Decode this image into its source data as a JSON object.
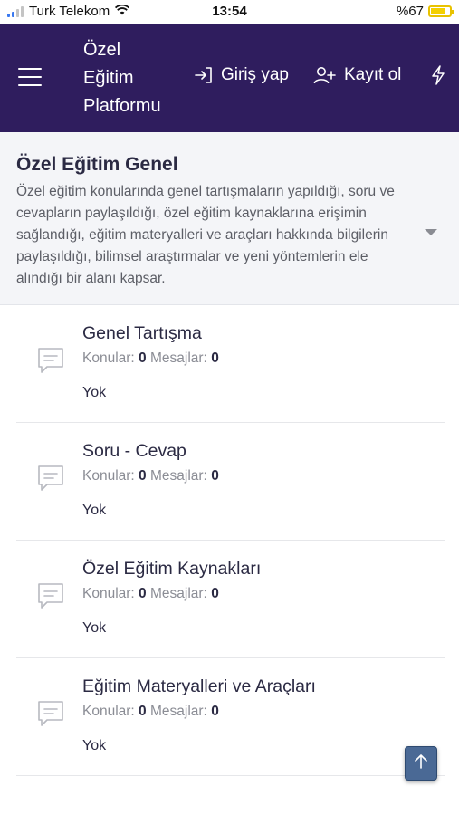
{
  "status_bar": {
    "carrier": "Turk Telekom",
    "time": "13:54",
    "battery": "%67"
  },
  "header": {
    "brand_line1": "Özel",
    "brand_line2": "Eğitim",
    "brand_line3": "Platformu",
    "login_label": "Giriş yap",
    "register_label": "Kayıt ol",
    "icons": [
      "menu-icon",
      "login-icon",
      "user-add-icon",
      "bolt-icon"
    ]
  },
  "category": {
    "title": "Özel Eğitim Genel",
    "description": "Özel eğitim konularında genel tartışmaların yapıldığı, soru ve cevapların paylaşıldığı, özel eğitim kaynaklarına erişimin sağlandığı, eğitim materyalleri ve araçları hakkında bilgilerin paylaşıldığı, bilimsel araştırmalar ve yeni yöntemlerin ele alındığı bir alanı kapsar."
  },
  "forums": [
    {
      "title": "Genel Tartışma",
      "threads_label": "Konular:",
      "threads": "0",
      "messages_label": "Mesajlar:",
      "messages": "0",
      "last_post": "Yok"
    },
    {
      "title": "Soru - Cevap",
      "threads_label": "Konular:",
      "threads": "0",
      "messages_label": "Mesajlar:",
      "messages": "0",
      "last_post": "Yok"
    },
    {
      "title": "Özel Eğitim Kaynakları",
      "threads_label": "Konular:",
      "threads": "0",
      "messages_label": "Mesajlar:",
      "messages": "0",
      "last_post": "Yok"
    },
    {
      "title": "Eğitim Materyalleri ve Araçları",
      "threads_label": "Konular:",
      "threads": "0",
      "messages_label": "Mesajlar:",
      "messages": "0",
      "last_post": "Yok"
    }
  ],
  "colors": {
    "header_bg": "#2f1d5e",
    "category_bg": "#f4f5f8",
    "title_text": "#2b2a43",
    "scroll_top_bg": "#4a6995"
  }
}
